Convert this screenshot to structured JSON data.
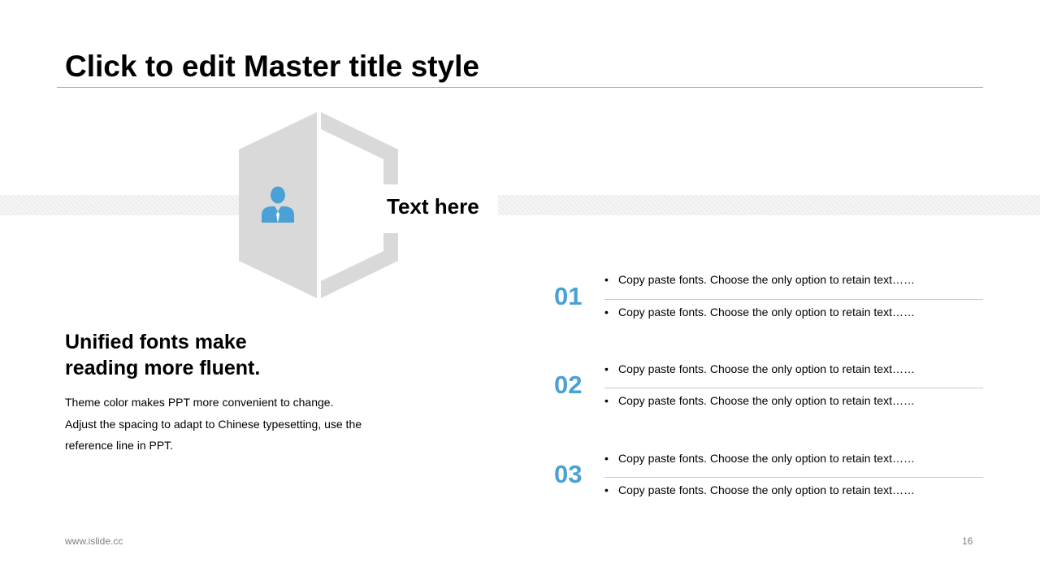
{
  "slide": {
    "title": "Click to edit Master title style",
    "hexagon_label": "Text here",
    "hexagon_icon": "person-icon",
    "headline_lines": [
      "Unified fonts make",
      "reading more fluent."
    ],
    "body_lines": [
      "Theme color makes PPT more convenient to change.",
      "Adjust the spacing to adapt to Chinese typesetting, use the",
      "reference line in PPT."
    ],
    "groups": [
      {
        "number": "01",
        "items": [
          "Copy paste fonts. Choose the only option to retain text……",
          "Copy paste fonts. Choose the only option to retain text……"
        ]
      },
      {
        "number": "02",
        "items": [
          "Copy paste fonts. Choose the only option to retain text……",
          "Copy paste fonts. Choose the only option to retain text……"
        ]
      },
      {
        "number": "03",
        "items": [
          "Copy paste fonts. Choose the only option to retain text……",
          "Copy paste fonts. Choose the only option to retain text……"
        ]
      }
    ],
    "footer_url": "www.islide.cc",
    "page_number": "16"
  },
  "colors": {
    "accent": "#4ba1d6",
    "shape_gray": "#d9d9d9",
    "rule_gray": "#a6a6a6"
  }
}
